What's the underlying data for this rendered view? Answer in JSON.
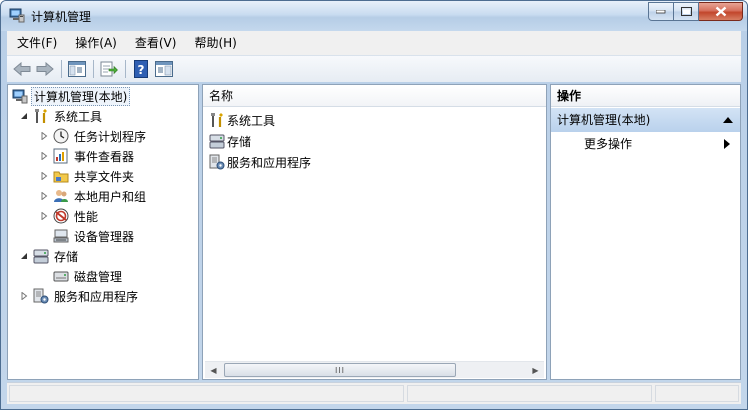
{
  "window": {
    "title": "计算机管理",
    "caption_buttons": [
      "minimize",
      "maximize",
      "close"
    ]
  },
  "menubar": {
    "items": [
      "文件(F)",
      "操作(A)",
      "查看(V)",
      "帮助(H)"
    ]
  },
  "toolbar": {
    "buttons": [
      "back-icon",
      "forward-icon",
      "show-hide-console-tree-icon",
      "export-list-icon",
      "help-icon",
      "show-hide-action-pane-icon"
    ]
  },
  "tree": {
    "root": "计算机管理(本地)",
    "nodes": [
      {
        "label": "系统工具",
        "icon": "tools-icon",
        "expanded": true
      },
      {
        "label": "任务计划程序",
        "icon": "clock-icon"
      },
      {
        "label": "事件查看器",
        "icon": "event-viewer-icon"
      },
      {
        "label": "共享文件夹",
        "icon": "shared-folder-icon"
      },
      {
        "label": "本地用户和组",
        "icon": "users-icon"
      },
      {
        "label": "性能",
        "icon": "performance-icon"
      },
      {
        "label": "设备管理器",
        "icon": "device-manager-icon"
      },
      {
        "label": "存储",
        "icon": "storage-icon",
        "expanded": true
      },
      {
        "label": "磁盘管理",
        "icon": "disk-icon"
      },
      {
        "label": "服务和应用程序",
        "icon": "services-icon"
      }
    ]
  },
  "list": {
    "column": "名称",
    "items": [
      {
        "label": "系统工具",
        "icon": "tools-icon"
      },
      {
        "label": "存储",
        "icon": "storage-icon"
      },
      {
        "label": "服务和应用程序",
        "icon": "services-icon"
      }
    ],
    "scroll_thumb_glyph": "III"
  },
  "actions": {
    "header": "操作",
    "section": "计算机管理(本地)",
    "items": [
      "更多操作"
    ]
  },
  "colors": {
    "selection_bg": "#b9d1ec",
    "frame": "#4d6d91"
  }
}
